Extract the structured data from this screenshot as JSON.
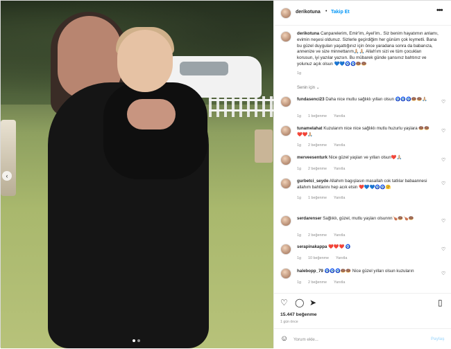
{
  "post_header": {
    "username": "derikotuna",
    "separator": "•",
    "follow_label": "Takip Et",
    "more_label": "•••"
  },
  "caption": {
    "username": "derikotuna",
    "text": "Canparelerim, Emir'im, Ayel'im.. Siz benim hayatımın anlamı, evimin neşesi oldunuz. Sizlerle geçirdiğim her günüm çok kıymetli. Bana bu güzel duyguları yaşattığınız için önce yaradana sonra da babanıza, annenize ve size minnettarım🙏🏼🙏🏼 Allah'ım sizi ve tüm çocukları korusun, iyi yazılar yazsın. Bu mübarek günde şansınız bahtınız ve yolunuz açık olsun 💙💙🧿🧿🍩🍩",
    "time": "1g"
  },
  "sort_label": "Senin için ⌄",
  "comments": [
    {
      "username": "fundasenci23",
      "text": "Daha nice mutlu sağlıklı yılları olsun 🧿🧿🧿🍩🍩🙏🏼",
      "time": "1g",
      "likes": "1 beğenme",
      "reply": "Yanıtla"
    },
    {
      "username": "tunamelahat",
      "text": "Kuzularım nice nice sağlıklı mutlu huzurlu yaşlara 🍩🍩❤️❤️🙏🏼",
      "time": "1g",
      "likes": "2 beğenme",
      "reply": "Yanıtla"
    },
    {
      "username": "merveesenturk",
      "text": "Nice güzel yaşları ve yılları olsun❤️🙏🏼",
      "time": "1g",
      "likes": "2 beğenme",
      "reply": "Yanıtla"
    },
    {
      "username": "gurbetci_seyde",
      "text": "Allahım bagışlasın masallah cok tatlılar babaannesi allahım bahtlarını hep acık etsin ❤️💙💙🧿🧿🤗",
      "time": "1g",
      "likes": "1 beğenme",
      "reply": "Yanıtla"
    },
    {
      "username": "serdarenser",
      "text": "Sağlıklı, güzel, mutlu yaşları olsunnn🍗🍩🍗🍩",
      "time": "1g",
      "likes": "2 beğenme",
      "reply": "Yanıtla"
    },
    {
      "username": "serapinakappa",
      "text": "❤️❤️❤️ 🧿",
      "time": "1g",
      "likes": "10 beğenme",
      "reply": "Yanıtla"
    },
    {
      "username": "halebopp_79",
      "text": "🧿🧿🧿🍩🍩 Nice güzel yılları olsun kuzuların",
      "time": "1g",
      "likes": "2 beğenme",
      "reply": "Yanıtla"
    }
  ],
  "actions": {
    "like_icon": "heart-icon",
    "comment_icon": "comment-icon",
    "share_icon": "send-icon",
    "save_icon": "bookmark-icon"
  },
  "likes_count": "15.447 beğenme",
  "posted_ago": "1 gün önce",
  "add_comment": {
    "placeholder": "Yorum ekle...",
    "share_label": "Paylaş"
  },
  "colors": {
    "follow": "#0095f6",
    "share_disabled": "#b2dffc",
    "meta": "#8e8e8e"
  }
}
